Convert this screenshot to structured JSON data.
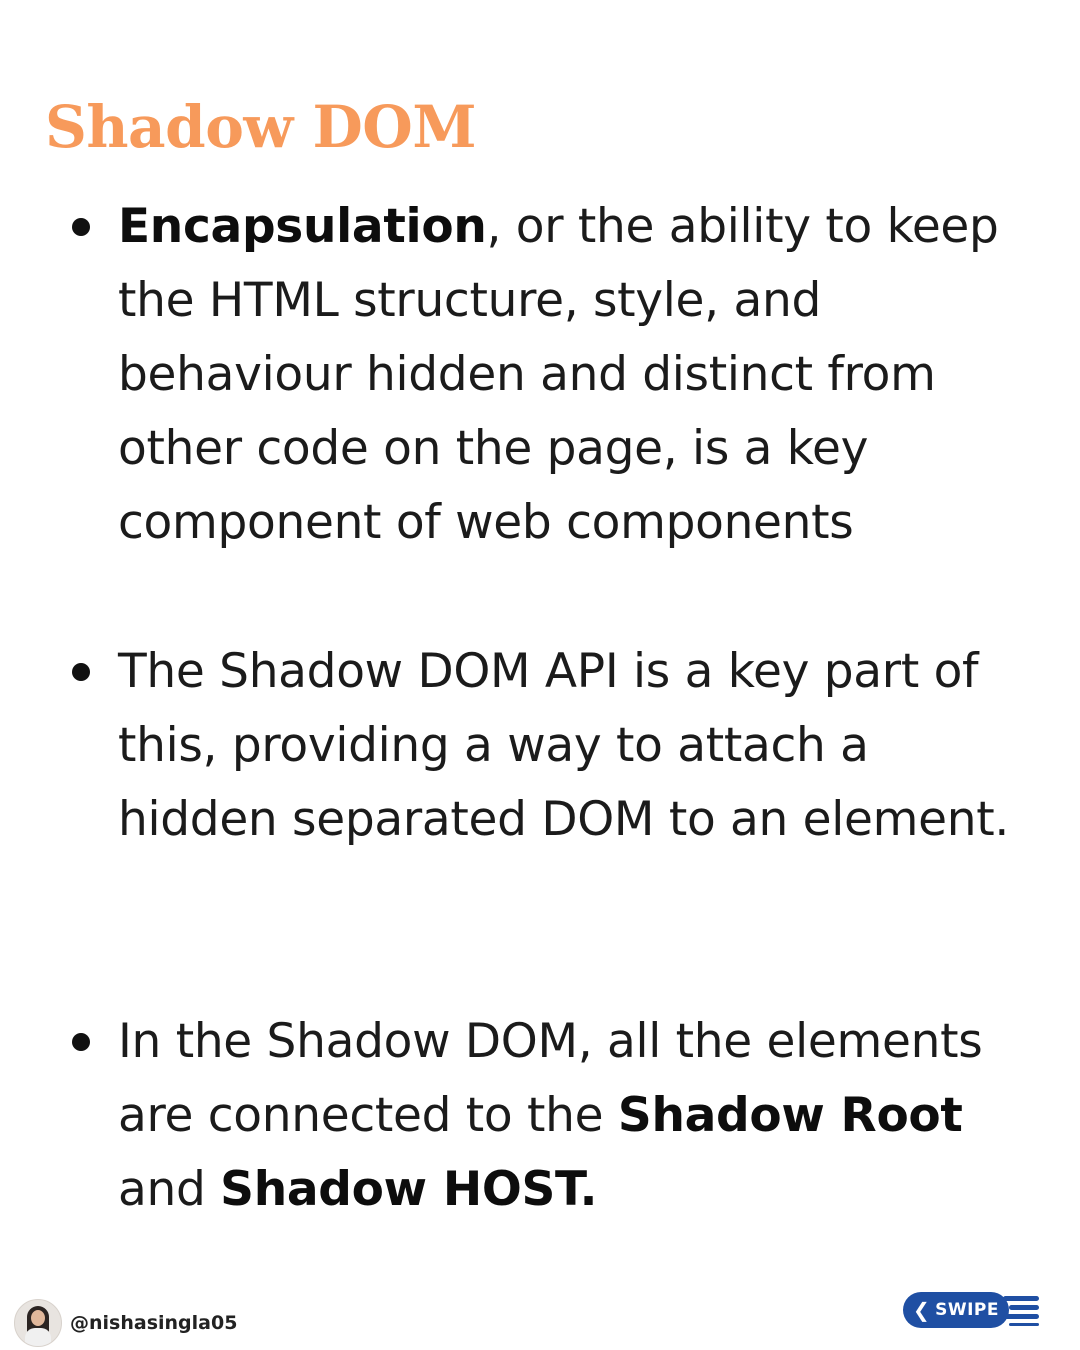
{
  "title": "Shadow DOM",
  "bullets": [
    {
      "parts": [
        {
          "text": "Encapsulation",
          "bold": true
        },
        {
          "text": ", or the ability to keep the HTML structure, style, and behaviour hidden and distinct from other code on the page, is a key component of web components",
          "bold": false
        }
      ]
    },
    {
      "parts": [
        {
          "text": "The Shadow DOM API is a key part of this, providing a way to attach a hidden separated DOM to an element.",
          "bold": false
        }
      ]
    },
    {
      "parts": [
        {
          "text": "In the Shadow DOM, all the elements are connected to the ",
          "bold": false
        },
        {
          "text": "Shadow Root",
          "bold": true
        },
        {
          "text": " and ",
          "bold": false
        },
        {
          "text": "Shadow HOST.",
          "bold": true
        }
      ]
    }
  ],
  "footer": {
    "handle": "@nishasingla05",
    "avatar_icon": "profile-photo",
    "swipe_label": "SWIPE",
    "swipe_icon": "chevron-left-icon"
  },
  "colors": {
    "title": "#f79a5b",
    "text": "#1b1b1b",
    "swipe": "#1f4fa3",
    "background": "#ffffff"
  }
}
